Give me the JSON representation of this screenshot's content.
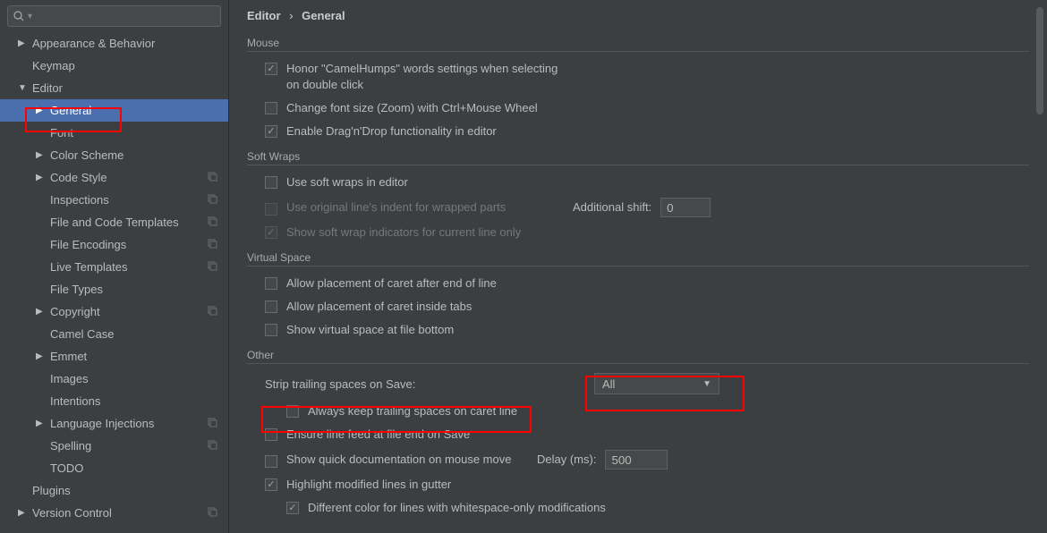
{
  "search": {
    "placeholder": ""
  },
  "breadcrumb": {
    "part1": "Editor",
    "sep": "›",
    "part2": "General"
  },
  "sidebar": {
    "items": [
      {
        "label": "Appearance & Behavior",
        "arrow": "▶",
        "level": 1
      },
      {
        "label": "Keymap",
        "arrow": "",
        "level": 1
      },
      {
        "label": "Editor",
        "arrow": "▼",
        "level": 1
      },
      {
        "label": "General",
        "arrow": "▶",
        "level": 2,
        "selected": true
      },
      {
        "label": "Font",
        "arrow": "",
        "level": 2
      },
      {
        "label": "Color Scheme",
        "arrow": "▶",
        "level": 2
      },
      {
        "label": "Code Style",
        "arrow": "▶",
        "level": 2,
        "copy": true
      },
      {
        "label": "Inspections",
        "arrow": "",
        "level": 2,
        "copy": true
      },
      {
        "label": "File and Code Templates",
        "arrow": "",
        "level": 2,
        "copy": true
      },
      {
        "label": "File Encodings",
        "arrow": "",
        "level": 2,
        "copy": true
      },
      {
        "label": "Live Templates",
        "arrow": "",
        "level": 2,
        "copy": true
      },
      {
        "label": "File Types",
        "arrow": "",
        "level": 2
      },
      {
        "label": "Copyright",
        "arrow": "▶",
        "level": 2,
        "copy": true
      },
      {
        "label": "Camel Case",
        "arrow": "",
        "level": 2
      },
      {
        "label": "Emmet",
        "arrow": "▶",
        "level": 2
      },
      {
        "label": "Images",
        "arrow": "",
        "level": 2
      },
      {
        "label": "Intentions",
        "arrow": "",
        "level": 2
      },
      {
        "label": "Language Injections",
        "arrow": "▶",
        "level": 2,
        "copy": true
      },
      {
        "label": "Spelling",
        "arrow": "",
        "level": 2,
        "copy": true
      },
      {
        "label": "TODO",
        "arrow": "",
        "level": 2
      },
      {
        "label": "Plugins",
        "arrow": "",
        "level": 1
      },
      {
        "label": "Version Control",
        "arrow": "▶",
        "level": 1,
        "copy": true
      }
    ]
  },
  "sections": {
    "mouse": {
      "title": "Mouse",
      "opt1": "Honor \"CamelHumps\" words settings when selecting on double click",
      "opt2": "Change font size (Zoom) with Ctrl+Mouse Wheel",
      "opt3": "Enable Drag'n'Drop functionality in editor"
    },
    "softwraps": {
      "title": "Soft Wraps",
      "opt1": "Use soft wraps in editor",
      "opt2": "Use original line's indent for wrapped parts",
      "shift_label": "Additional shift:",
      "shift_value": "0",
      "opt3": "Show soft wrap indicators for current line only"
    },
    "virtual": {
      "title": "Virtual Space",
      "opt1": "Allow placement of caret after end of line",
      "opt2": "Allow placement of caret inside tabs",
      "opt3": "Show virtual space at file bottom"
    },
    "other": {
      "title": "Other",
      "strip_label": "Strip trailing spaces on Save:",
      "strip_value": "All",
      "opt1": "Always keep trailing spaces on caret line",
      "opt2": "Ensure line feed at file end on Save",
      "opt3": "Show quick documentation on mouse move",
      "delay_label": "Delay (ms):",
      "delay_value": "500",
      "opt4": "Highlight modified lines in gutter",
      "opt5": "Different color for lines with whitespace-only modifications"
    }
  }
}
